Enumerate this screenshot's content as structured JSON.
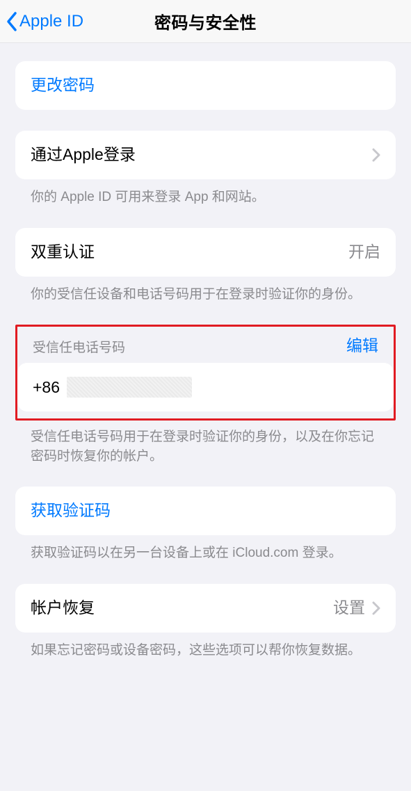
{
  "nav": {
    "back_label": "Apple ID",
    "title": "密码与安全性"
  },
  "change_password": {
    "label": "更改密码"
  },
  "sign_in_with_apple": {
    "label": "通过Apple登录",
    "footer": "你的 Apple ID 可用来登录 App 和网站。"
  },
  "two_factor": {
    "label": "双重认证",
    "value": "开启",
    "footer": "你的受信任设备和电话号码用于在登录时验证你的身份。"
  },
  "trusted_phone": {
    "header": "受信任电话号码",
    "edit": "编辑",
    "prefix": "+86",
    "footer": "受信任电话号码用于在登录时验证你的身份，以及在你忘记密码时恢复你的帐户。"
  },
  "get_code": {
    "label": "获取验证码",
    "footer": "获取验证码以在另一台设备上或在 iCloud.com 登录。"
  },
  "account_recovery": {
    "label": "帐户恢复",
    "value": "设置",
    "footer": "如果忘记密码或设备密码，这些选项可以帮你恢复数据。"
  }
}
